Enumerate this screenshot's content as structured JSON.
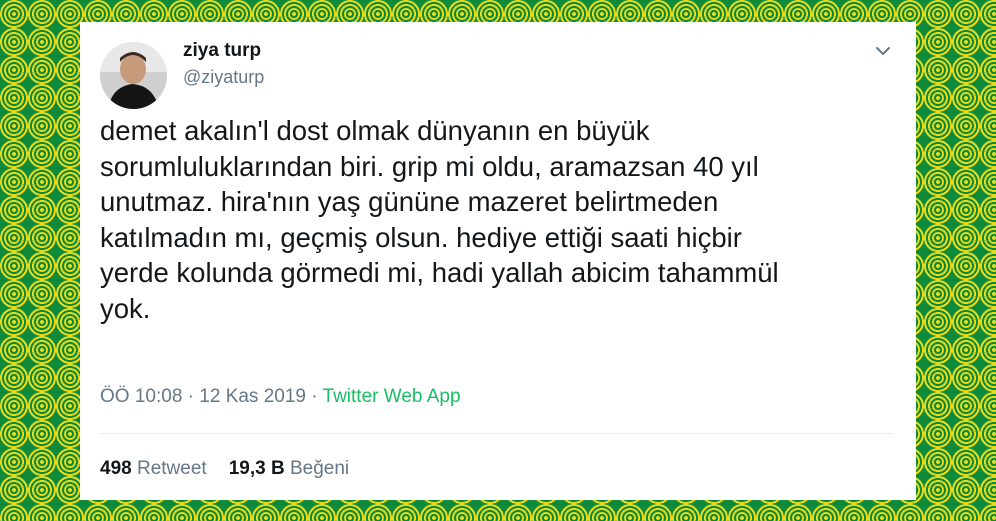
{
  "tweet": {
    "author_name": "ziya turp",
    "author_handle": "@ziyaturp",
    "text": "demet akalın'l dost olmak dünyanın en büyük\nsorumluluklarından biri. grip mi oldu, aramazsan 40 yıl\nunutmaz. hira'nın yaş gününe mazeret belirtmeden\nkatılmadın mı, geçmiş olsun. hediye ettiği saati hiçbir\nyerde kolunda görmedi mi, hadi yallah abicim tahammül\nyok.",
    "time": "ÖÖ 10:08",
    "date": "12 Kas 2019",
    "separator": "·",
    "source": "Twitter Web App",
    "retweet_count": "498",
    "retweet_label": "Retweet",
    "like_count": "19,3 B",
    "like_label": "Beğeni"
  },
  "icons": {
    "menu": "chevron-down-icon",
    "avatar": "avatar"
  },
  "colors": {
    "background_green": "#0f8a3a",
    "background_yellow": "#e6d81a",
    "text_primary": "#14171a",
    "text_secondary": "#657786",
    "source_green": "#17bf63",
    "divider": "#e6ecf0"
  }
}
